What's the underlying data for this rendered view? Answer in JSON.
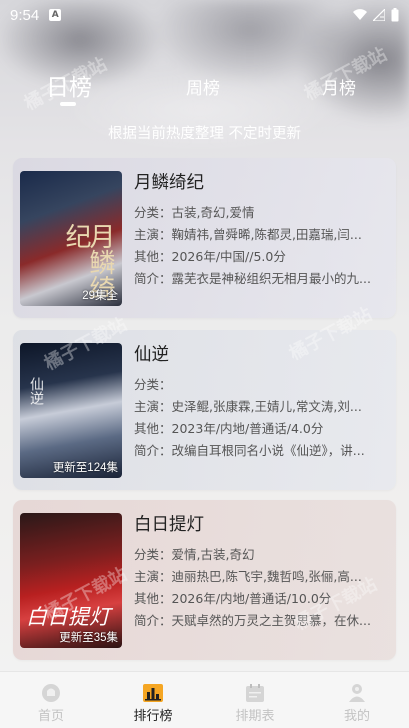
{
  "status_bar": {
    "time": "9:54",
    "app_badge": "A"
  },
  "tabs": [
    {
      "label": "日榜",
      "active": true
    },
    {
      "label": "周榜",
      "active": false
    },
    {
      "label": "月榜",
      "active": false
    }
  ],
  "subtitle": "根据当前热度整理 不定时更新",
  "labels": {
    "category": "分类：",
    "cast": "主演：",
    "other": "其他：",
    "intro": "简介："
  },
  "items": [
    {
      "title": "月鳞绮纪",
      "episodes": "29集全",
      "category": "古装,奇幻,爱情",
      "cast": "鞠婧祎,曾舜晞,陈都灵,田嘉瑞,闫...",
      "other": "2026年/中国//5.0分",
      "intro": "露芜衣是神秘组织无相月最小的九...",
      "poster_text": "月鳞绮纪"
    },
    {
      "title": "仙逆",
      "episodes": "更新至124集",
      "category": "",
      "cast": "史泽鲲,张康霖,王婧儿,常文涛,刘...",
      "other": "2023年/内地/普通话/4.0分",
      "intro": "改编自耳根同名小说《仙逆》，讲...",
      "poster_text": "仙逆"
    },
    {
      "title": "白日提灯",
      "episodes": "更新至35集",
      "category": "爱情,古装,奇幻",
      "cast": "迪丽热巴,陈飞宇,魏哲鸣,张俪,高...",
      "other": "2026年/内地/普通话/10.0分",
      "intro": "天赋卓然的万灵之主贺思慕，在休...",
      "poster_text": "白日提灯"
    }
  ],
  "watermark": "橘子下载站",
  "nav": [
    {
      "label": "首页",
      "icon": "home-icon",
      "active": false
    },
    {
      "label": "排行榜",
      "icon": "ranking-icon",
      "active": true
    },
    {
      "label": "排期表",
      "icon": "calendar-icon",
      "active": false
    },
    {
      "label": "我的",
      "icon": "profile-icon",
      "active": false
    }
  ],
  "colors": {
    "active_nav_icon": "#f5a623",
    "inactive": "#c3c3c3"
  }
}
